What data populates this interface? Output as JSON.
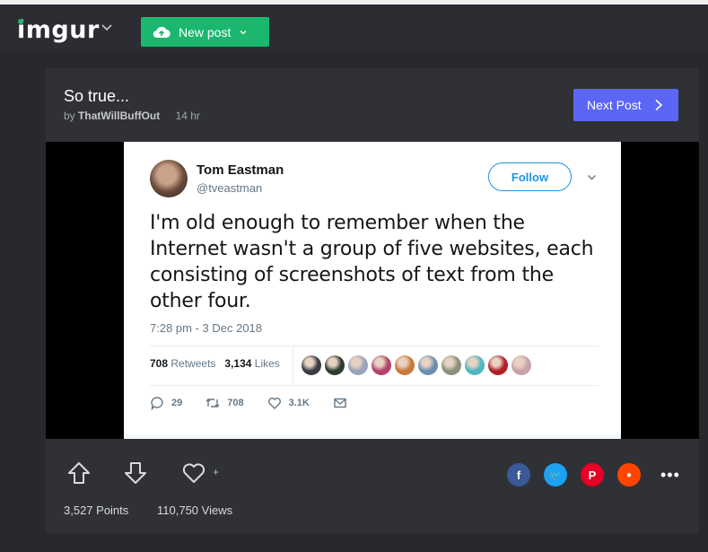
{
  "header": {
    "logo": "imgur",
    "new_post_label": "New post"
  },
  "post": {
    "title": "So true...",
    "by_label": "by",
    "author": "ThatWillBuffOut",
    "time": "14 hr",
    "next_label": "Next Post"
  },
  "tweet": {
    "name": "Tom Eastman",
    "handle": "@tveastman",
    "follow_label": "Follow",
    "text": "I'm old enough to remember when the Internet wasn't a group of five websites, each consisting of screenshots of text from the other four.",
    "date": "7:28 pm - 3 Dec 2018",
    "retweets_count": "708",
    "retweets_label": "Retweets",
    "likes_count": "3,134",
    "likes_label": "Likes",
    "replies": "29",
    "retweets_action": "708",
    "likes_action": "3.1K",
    "liker_colors": [
      "#3a3d42",
      "#2e3b30",
      "#9aa3b8",
      "#b5426c",
      "#c87a3a",
      "#6b8fb0",
      "#8a8f7a",
      "#4fb7c2",
      "#b01f2a",
      "#c9a2a8"
    ]
  },
  "footer": {
    "fav_plus": "+",
    "points": "3,527 Points",
    "views": "110,750 Views",
    "share_icons": [
      {
        "name": "facebook-icon",
        "color": "#3b5998",
        "glyph": "f"
      },
      {
        "name": "twitter-icon",
        "color": "#1da1f2",
        "glyph": "🐦"
      },
      {
        "name": "pinterest-icon",
        "color": "#e60023",
        "glyph": "P"
      },
      {
        "name": "reddit-icon",
        "color": "#ff4500",
        "glyph": "●"
      }
    ],
    "more": "•••"
  },
  "colors": {
    "accent_green": "#1bb76e",
    "next_blue": "#5b66f6",
    "twitter_blue": "#1b95e0"
  }
}
